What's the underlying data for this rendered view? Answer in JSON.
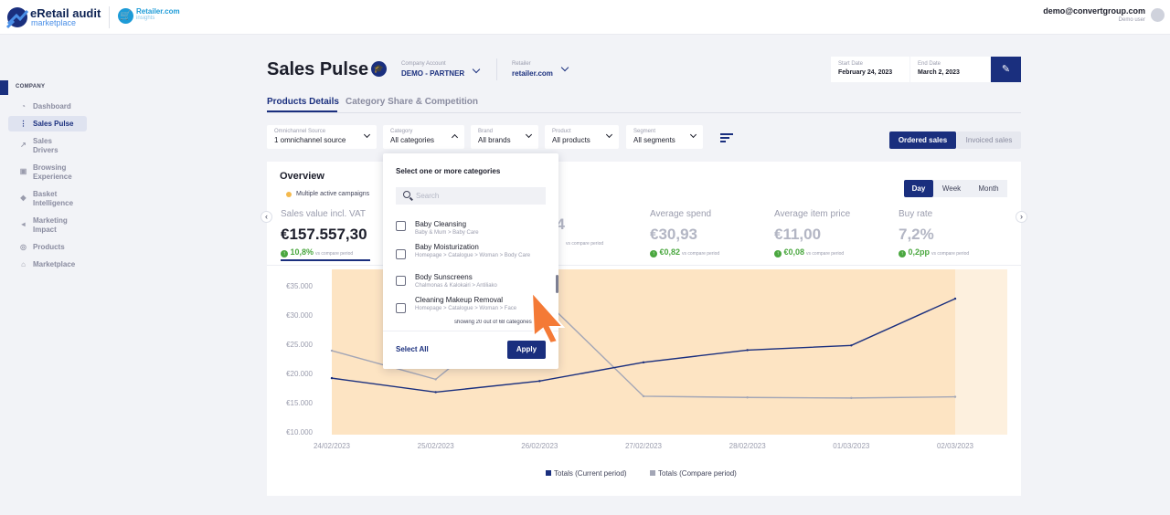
{
  "topbar": {
    "brand_title": "eRetail audit",
    "brand_sub": "marketplace",
    "retailer_logo_name": "Retailer.com",
    "retailer_logo_sub": "insights",
    "user_email": "demo@convertgroup.com",
    "user_role": "Demo user"
  },
  "sidebar": {
    "heading": "COMPANY",
    "items": [
      {
        "label": "Dashboard",
        "icon": "pie-chart-icon"
      },
      {
        "label": "Sales Pulse",
        "icon": "pulse-icon",
        "active": true
      },
      {
        "label": "Sales Drivers",
        "icon": "trend-icon"
      },
      {
        "label": "Browsing Experience",
        "icon": "browse-icon"
      },
      {
        "label": "Basket Intelligence",
        "icon": "basket-icon"
      },
      {
        "label": "Marketing Impact",
        "icon": "megaphone-icon"
      },
      {
        "label": "Products",
        "icon": "products-icon"
      },
      {
        "label": "Marketplace",
        "icon": "home-icon"
      }
    ]
  },
  "header": {
    "title": "Sales Pulse",
    "company_label": "Company Account",
    "company_value": "DEMO - PARTNER",
    "retailer_label": "Retailer",
    "retailer_value": "retailer.com",
    "start_label": "Start Date",
    "start_value": "February 24, 2023",
    "end_label": "End Date",
    "end_value": "March 2, 2023"
  },
  "tabs": [
    {
      "label": "Products Details",
      "active": true
    },
    {
      "label": "Category Share & Competition",
      "active": false
    }
  ],
  "filters": [
    {
      "label": "Omnichannel Source",
      "value": "1 omnichannel source"
    },
    {
      "label": "Category",
      "value": "All categories"
    },
    {
      "label": "Brand",
      "value": "All brands"
    },
    {
      "label": "Product",
      "value": "All products"
    },
    {
      "label": "Segment",
      "value": "All segments"
    }
  ],
  "sales_toggle": {
    "ordered": "Ordered sales",
    "invoiced": "Invoiced sales",
    "selected": "ordered"
  },
  "overview": {
    "title": "Overview",
    "campaign_note": "Multiple active campaigns",
    "periods": [
      "Day",
      "Week",
      "Month"
    ],
    "selected_period": "Day"
  },
  "kpis": [
    {
      "label": "Sales value incl. VAT",
      "value": "€157.557,30",
      "delta": "10,8%",
      "note": "vs compare period"
    },
    {
      "label": "",
      "value": "04",
      "delta": "",
      "note": "vs compare period"
    },
    {
      "label": "Average spend",
      "value": "€30,93",
      "delta": "€0,82",
      "note": "vs compare period"
    },
    {
      "label": "Average item price",
      "value": "€11,00",
      "delta": "€0,08",
      "note": "vs compare period"
    },
    {
      "label": "Buy rate",
      "value": "7,2%",
      "delta": "0,2pp",
      "note": "vs compare period"
    }
  ],
  "colors": {
    "primary": "#1a2f7e",
    "positive": "#4aa73f",
    "campaign_band": "#fde4c3",
    "compare_line": "#a3a6b6",
    "cursor": "#f47a36"
  },
  "chart_data": {
    "type": "line",
    "x": [
      "24/02/2023",
      "25/02/2023",
      "26/02/2023",
      "27/02/2023",
      "28/02/2023",
      "01/03/2023",
      "02/03/2023"
    ],
    "y_ticks": [
      "€10.000",
      "€15.000",
      "€20.000",
      "€25.000",
      "€30.000",
      "€35.000"
    ],
    "ylim": [
      10000,
      37500
    ],
    "series": [
      {
        "name": "Totals (Current period)",
        "color": "#1a2f7e",
        "values": [
          19200,
          16800,
          18700,
          21900,
          24000,
          24800,
          32800
        ]
      },
      {
        "name": "Totals (Compare period)",
        "color": "#a3a6b6",
        "values": [
          23900,
          19000,
          33400,
          16100,
          15900,
          15800,
          16000
        ]
      }
    ],
    "campaign_band": {
      "from": "24/02/2023",
      "to": "02/03/2023"
    },
    "grid": false
  },
  "dropdown": {
    "title": "Select one or more categories",
    "search_placeholder": "Search",
    "items": [
      {
        "name": "Baby Cleansing",
        "path": "Baby & Mum > Baby Care"
      },
      {
        "name": "Baby Moisturization",
        "path": "Homepage > Catalogue > Woman > Body Care"
      },
      {
        "name": "Body Sunscreens",
        "path": "Chalmonas & Kalokairi > Antiliako"
      },
      {
        "name": "Cleaning Makeup Removal",
        "path": "Homepage > Catalogue > Woman > Face"
      }
    ],
    "count_text": "showing 20 out of 68 categories",
    "select_all": "Select All",
    "apply": "Apply"
  }
}
